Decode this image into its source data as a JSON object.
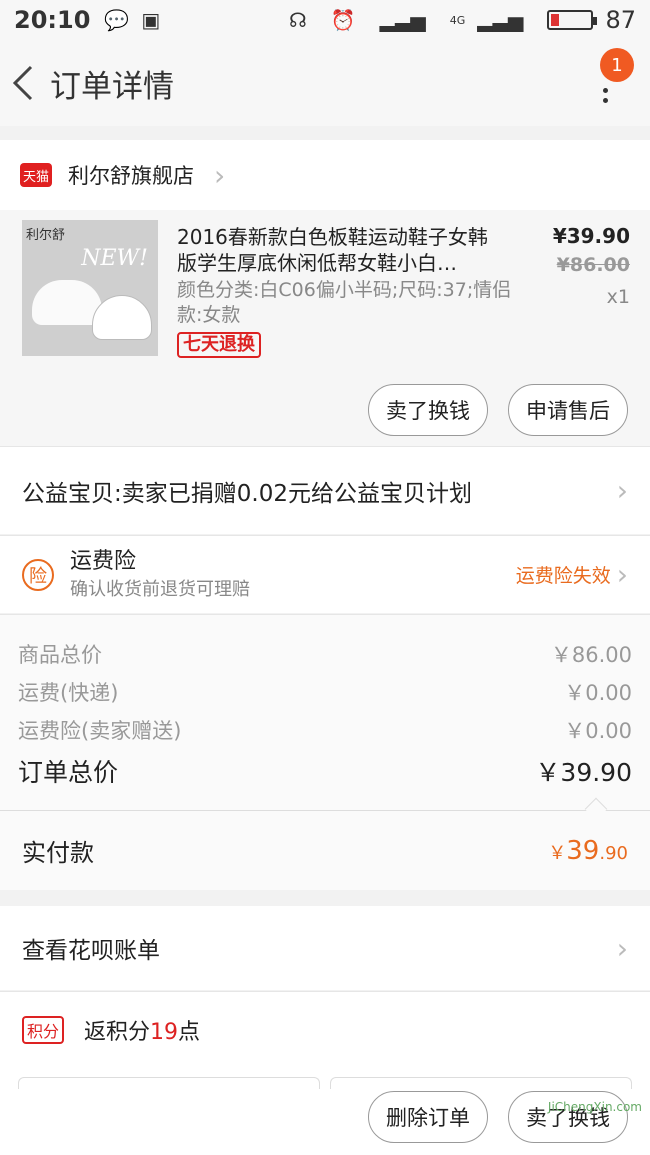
{
  "status": {
    "time": "20:10",
    "network": "4G",
    "battery": "87"
  },
  "nav": {
    "title": "订单详情",
    "badge": "1"
  },
  "shop": {
    "platform": "天猫",
    "name": "利尔舒旗舰店"
  },
  "product": {
    "thumb_text": "利尔舒",
    "thumb_new": "NEW!",
    "name": "2016春新款白色板鞋运动鞋子女韩版学生厚底休闲低帮女鞋小白…",
    "sku": "颜色分类:白C06偏小半码;尺码:37;情侣款:女款",
    "tag": "七天退换",
    "price": "¥39.90",
    "original_price": "¥86.00",
    "quantity": "x1"
  },
  "actions": {
    "sell_label": "卖了换钱",
    "aftersale_label": "申请售后"
  },
  "charity": {
    "text": "公益宝贝:卖家已捐赠0.02元给公益宝贝计划"
  },
  "insurance": {
    "icon": "险",
    "title": "运费险",
    "subtitle": "确认收货前退货可理赔",
    "status": "运费险失效"
  },
  "summary": [
    {
      "label": "商品总价",
      "value": "￥86.00"
    },
    {
      "label": "运费(快递)",
      "value": "￥0.00"
    },
    {
      "label": "运费险(卖家赠送)",
      "value": "￥0.00"
    }
  ],
  "total": {
    "label": "订单总价",
    "value": "￥39.90"
  },
  "paid": {
    "label": "实付款",
    "currency": "￥",
    "integer": "39",
    "decimal": ".90"
  },
  "huabei": {
    "text": "查看花呗账单"
  },
  "points": {
    "tag": "积分",
    "prefix": "返积分",
    "number": "19",
    "suffix": "点"
  },
  "bottom": {
    "delete_label": "删除订单",
    "sell_label": "卖了换钱"
  },
  "watermark": "JiChengXin.com",
  "colors": {
    "accent": "#e96b1f",
    "red": "#dd2222",
    "badge": "#f05a22"
  }
}
